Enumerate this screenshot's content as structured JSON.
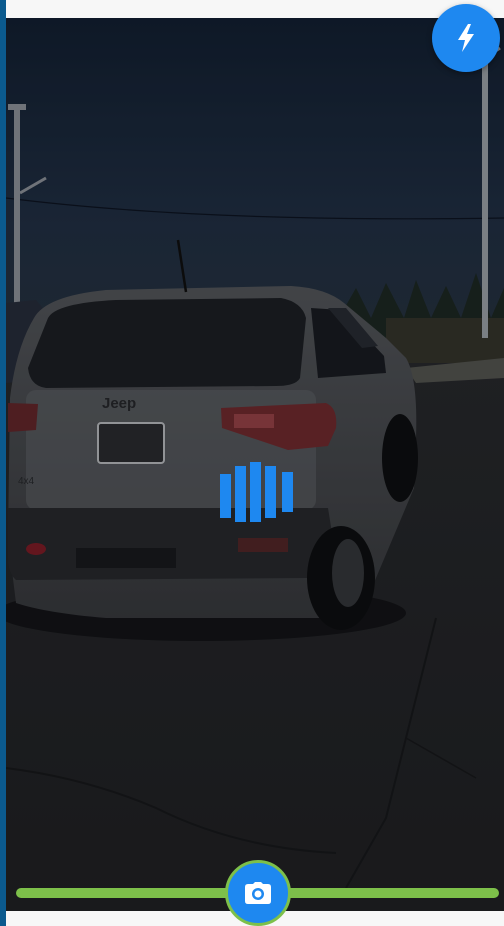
{
  "app": {
    "screen": "vehicle-photo-capture"
  },
  "camera": {
    "flash_icon": "lightning-bolt-icon",
    "capture_icon": "camera-icon",
    "scan_indicator_icon": "vertical-bars-icon"
  },
  "colors": {
    "accent": "#1e88f0",
    "progress": "#7dc04a",
    "sidebar_edge": "#0b5a8e"
  },
  "progress": {
    "fraction": 1.0
  },
  "scene": {
    "vehicle_badge": "Jeep",
    "trim_badge": "4x4"
  }
}
